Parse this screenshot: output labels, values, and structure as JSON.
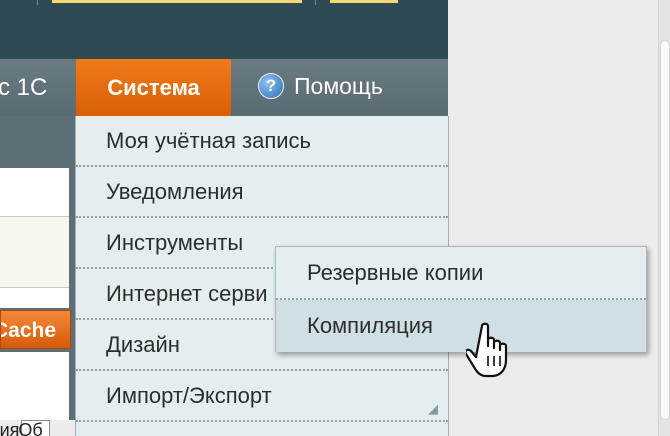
{
  "nav": {
    "partial_left": "с 1С",
    "sistema": "Система",
    "help": "Помощь"
  },
  "left": {
    "cache_button": "Cache",
    "bottom_text": "вия",
    "bottom_field": "Об"
  },
  "dropdown": {
    "items": [
      {
        "label": "Моя учётная запись"
      },
      {
        "label": "Уведомления"
      },
      {
        "label": "Инструменты"
      },
      {
        "label": "Интернет серви"
      },
      {
        "label": "Дизайн"
      },
      {
        "label": "Импорт/Экспорт"
      }
    ]
  },
  "submenu": {
    "items": [
      {
        "label": "Резервные копии"
      },
      {
        "label": "Компиляция"
      }
    ]
  },
  "colors": {
    "header": "#2d4a55",
    "active_tab": "#e56b10",
    "menu_bg": "#e4eef0",
    "hover_bg": "#cfdfe3"
  },
  "icons": {
    "help": "help-icon",
    "cursor": "hand-pointer-icon",
    "resize": "resize-grip-icon"
  }
}
